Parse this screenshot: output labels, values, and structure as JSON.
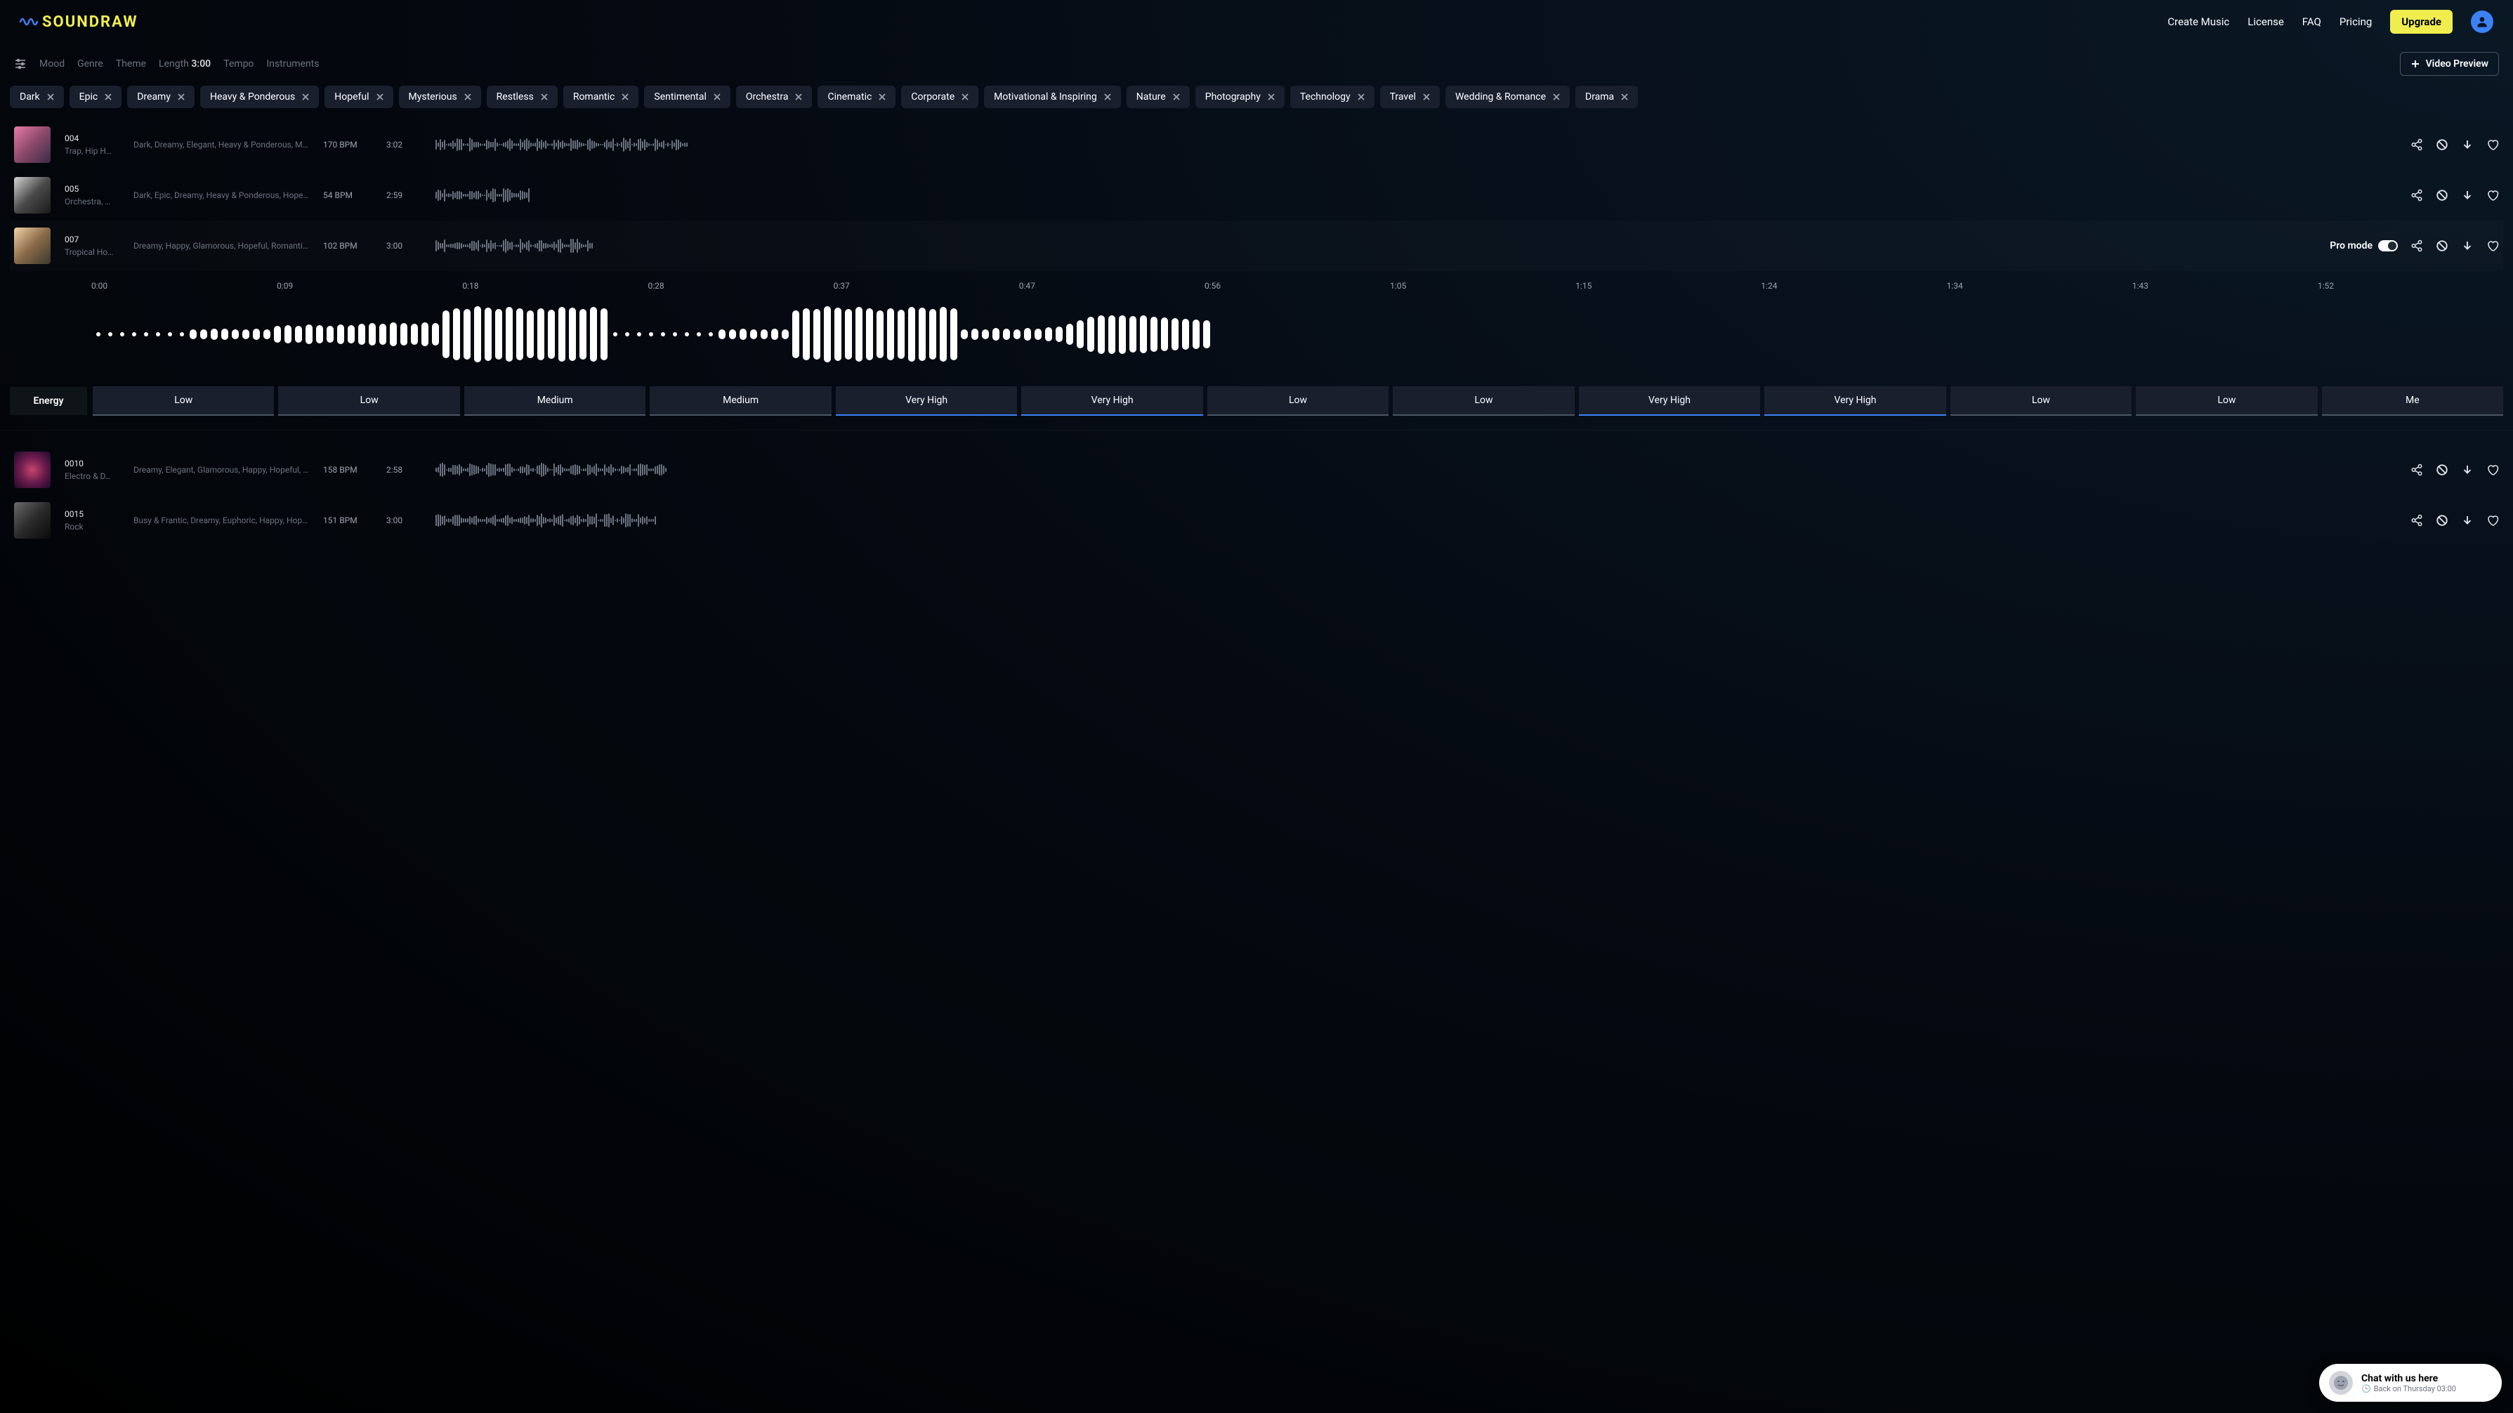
{
  "brand": {
    "name": "SOUNDRAW"
  },
  "nav": {
    "create": "Create Music",
    "license": "License",
    "faq": "FAQ",
    "pricing": "Pricing",
    "upgrade": "Upgrade"
  },
  "filters": {
    "mood": "Mood",
    "genre": "Genre",
    "theme": "Theme",
    "length_label": "Length",
    "length_value": "3:00",
    "tempo": "Tempo",
    "instruments": "Instruments",
    "video_preview": "Video Preview"
  },
  "tags": [
    "Dark",
    "Epic",
    "Dreamy",
    "Heavy & Ponderous",
    "Hopeful",
    "Mysterious",
    "Restless",
    "Romantic",
    "Sentimental",
    "Orchestra",
    "Cinematic",
    "Corporate",
    "Motivational & Inspiring",
    "Nature",
    "Photography",
    "Technology",
    "Travel",
    "Wedding & Romance",
    "Drama"
  ],
  "tracks": [
    {
      "id": "004",
      "genre": "Trap, Hip H…",
      "moods": "Dark, Dreamy, Elegant, Heavy & Ponderous, Mys…",
      "bpm": "170 BPM",
      "dur": "3:02",
      "thumb": "linear-gradient(135deg,#e879a5,#8b4a6b,#3a2a45)",
      "waveLen": 120,
      "selected": false
    },
    {
      "id": "005",
      "genre": "Orchestra, …",
      "moods": "Dark, Epic, Dreamy, Heavy & Ponderous, Hopefu…",
      "bpm": "54 BPM",
      "dur": "2:59",
      "thumb": "linear-gradient(135deg,#d4d4d4,#4a4a4a,#1a1a1a)",
      "waveLen": 45,
      "selected": false
    },
    {
      "id": "007",
      "genre": "Tropical Ho…",
      "moods": "Dreamy, Happy, Glamorous, Hopeful, Romantic, …",
      "bpm": "102 BPM",
      "dur": "3:00",
      "thumb": "linear-gradient(135deg,#f4d4a4,#8a6a4a,#3a3a2a)",
      "waveLen": 75,
      "selected": true,
      "proMode": true
    },
    {
      "id": "0010",
      "genre": "Electro & D…",
      "moods": "Dreamy, Elegant, Glamorous, Happy, Hopeful, Sexy",
      "bpm": "158 BPM",
      "dur": "2:58",
      "thumb": "radial-gradient(circle,#c44569,#6a1b4d,#1a0a2a)",
      "waveLen": 110,
      "selected": false
    },
    {
      "id": "0015",
      "genre": "Rock",
      "moods": "Busy & Frantic, Dreamy, Euphoric, Happy, Hopef…",
      "bpm": "151 BPM",
      "dur": "3:00",
      "thumb": "linear-gradient(135deg,#6a6a6a,#2a2a2a,#0a0a0a)",
      "waveLen": 105,
      "selected": false
    }
  ],
  "editor": {
    "times": [
      "0:00",
      "0:09",
      "0:18",
      "0:28",
      "0:37",
      "0:47",
      "0:56",
      "1:05",
      "1:15",
      "1:24",
      "1:34",
      "1:43",
      "1:52"
    ],
    "energy_label": "Energy",
    "energy": [
      {
        "label": "Low",
        "high": false
      },
      {
        "label": "Low",
        "high": false
      },
      {
        "label": "Medium",
        "high": false
      },
      {
        "label": "Medium",
        "high": false
      },
      {
        "label": "Very High",
        "high": true
      },
      {
        "label": "Very High",
        "high": true
      },
      {
        "label": "Low",
        "high": false
      },
      {
        "label": "Low",
        "high": false
      },
      {
        "label": "Very High",
        "high": true
      },
      {
        "label": "Very High",
        "high": true
      },
      {
        "label": "Low",
        "high": false
      },
      {
        "label": "Low",
        "high": false
      },
      {
        "label": "Me",
        "high": false
      }
    ],
    "pro_mode_label": "Pro mode"
  },
  "chat": {
    "title": "Chat with us here",
    "sub": "Back on Thursday 03:00"
  }
}
